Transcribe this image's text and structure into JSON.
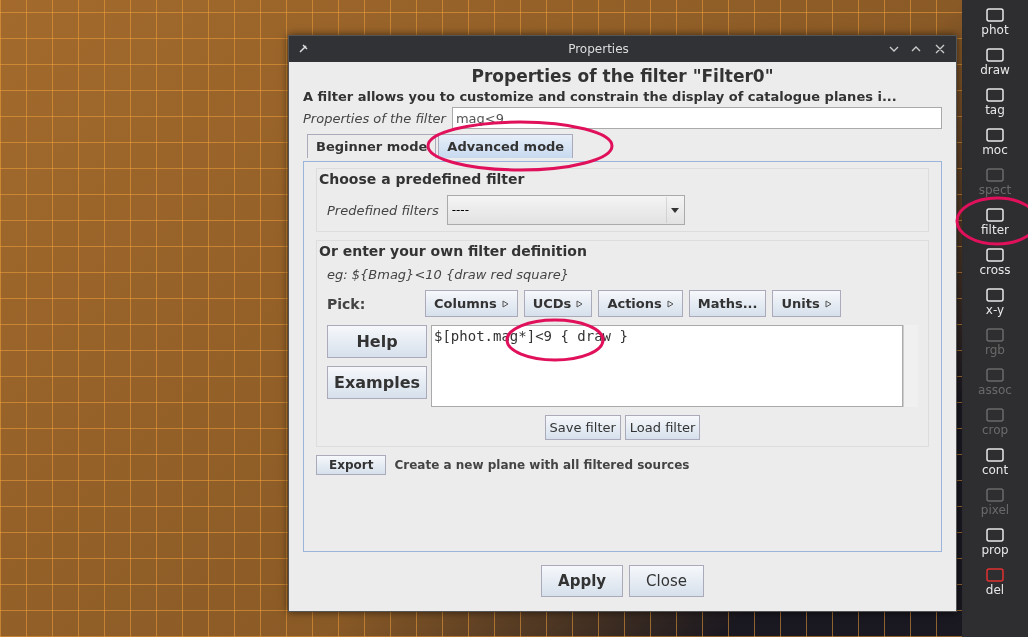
{
  "window": {
    "title": "Properties"
  },
  "heading": "Properties of the filter \"Filter0\"",
  "description": "A filter allows you to customize and constrain the display of catalogue planes i...",
  "name_field": {
    "label": "Properties of the filter",
    "value": "mag<9"
  },
  "tabs": [
    {
      "label": "Beginner mode",
      "selected": false
    },
    {
      "label": "Advanced mode",
      "selected": true
    }
  ],
  "predefined": {
    "title": "Choose a predefined filter",
    "label": "Predefined filters",
    "value": "----"
  },
  "custom": {
    "title": "Or enter your own filter definition",
    "example": "eg: ${Bmag}<10 {draw red square}",
    "pick_label": "Pick:",
    "pick_buttons": [
      {
        "label": "Columns",
        "menu": true
      },
      {
        "label": "UCDs",
        "menu": true
      },
      {
        "label": "Actions",
        "menu": true
      },
      {
        "label": "Maths...",
        "menu": false
      },
      {
        "label": "Units",
        "menu": true
      }
    ],
    "side_buttons": [
      "Help",
      "Examples"
    ],
    "definition": "$[phot.mag*]<9 { draw }",
    "file_buttons": [
      "Save filter",
      "Load filter"
    ]
  },
  "export": {
    "button": "Export",
    "text": "Create a new plane with all filtered sources"
  },
  "buttons": [
    {
      "label": "Apply",
      "default": true
    },
    {
      "label": "Close",
      "default": false
    }
  ],
  "toolbar": [
    {
      "label": "phot",
      "disabled": false
    },
    {
      "label": "draw",
      "disabled": false
    },
    {
      "label": "tag",
      "disabled": false
    },
    {
      "label": "moc",
      "disabled": false
    },
    {
      "label": "spect",
      "disabled": true
    },
    {
      "label": "filter",
      "disabled": false
    },
    {
      "label": "cross",
      "disabled": false
    },
    {
      "label": "x-y",
      "disabled": false
    },
    {
      "label": "rgb",
      "disabled": true
    },
    {
      "label": "assoc",
      "disabled": true
    },
    {
      "label": "crop",
      "disabled": true
    },
    {
      "label": "cont",
      "disabled": false
    },
    {
      "label": "pixel",
      "disabled": true
    },
    {
      "label": "prop",
      "disabled": false
    },
    {
      "label": "del",
      "disabled": false
    }
  ]
}
